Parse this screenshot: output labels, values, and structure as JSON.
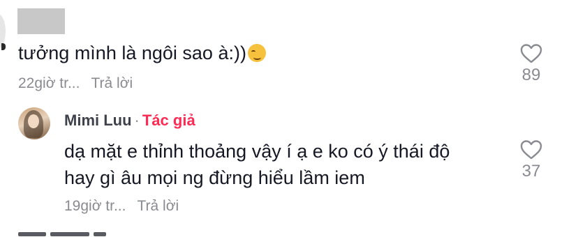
{
  "comment_1": {
    "text": "tưởng mình là ngôi sao à:))",
    "emoji": "smirk-emoji",
    "time": "22giờ tr...",
    "reply_label": "Trả lời",
    "likes": "89"
  },
  "comment_2": {
    "author": "Mimi Luu",
    "separator": "·",
    "badge": "Tác giả",
    "line_1": "dạ mặt e thỉnh thoảng vậy í ạ e ko có ý thái độ",
    "line_2": "hay gì âu mọi ng đừng hiểu lầm iem",
    "time": "19giờ tr...",
    "reply_label": "Trả lời",
    "likes": "37"
  },
  "colors": {
    "text": "#161823",
    "muted": "#8a8b91",
    "author_badge": "#fe2c55",
    "redaction": "#c8c8c8"
  },
  "icons": {
    "like": "heart-outline-icon"
  }
}
